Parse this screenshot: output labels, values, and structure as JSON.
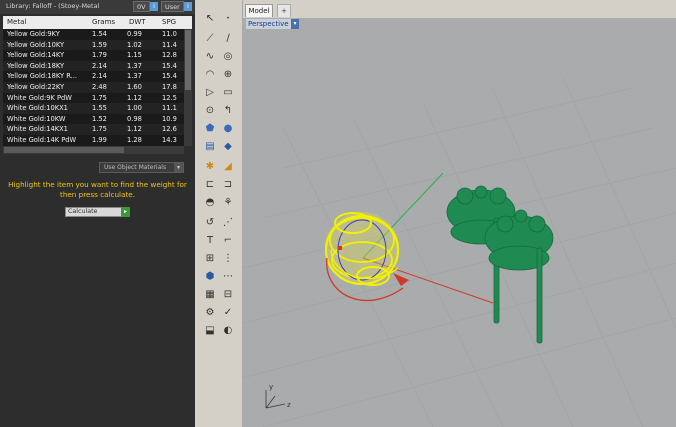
{
  "library": {
    "title": "Library: Falloff - (Stoey-Metal",
    "tag_0v": "0V",
    "tag_user": "User",
    "tag_btn": "i"
  },
  "table": {
    "columns": [
      "Metal",
      "Grams",
      "DWT",
      "SPG"
    ],
    "rows": [
      [
        "Yellow Gold:9KY",
        "1.54",
        "0.99",
        "11.0"
      ],
      [
        "Yellow Gold:10KY",
        "1.59",
        "1.02",
        "11.4"
      ],
      [
        "Yellow Gold:14KY",
        "1.79",
        "1.15",
        "12.8"
      ],
      [
        "Yellow Gold:18KY",
        "2.14",
        "1.37",
        "15.4"
      ],
      [
        "Yellow Gold:18KY R...",
        "2.14",
        "1.37",
        "15.4"
      ],
      [
        "Yellow Gold:22KY",
        "2.48",
        "1.60",
        "17.8"
      ],
      [
        "White Gold:9K PdW",
        "1.75",
        "1.12",
        "12.5"
      ],
      [
        "White Gold:10KX1",
        "1.55",
        "1.00",
        "11.1"
      ],
      [
        "White Gold:10KW",
        "1.52",
        "0.98",
        "10.9"
      ],
      [
        "White Gold:14KX1",
        "1.75",
        "1.12",
        "12.6"
      ],
      [
        "White Gold:14K PdW",
        "1.99",
        "1.28",
        "14.3"
      ]
    ]
  },
  "use_object_materials": "Use Object Materials",
  "hint": "Highlight the item you want to find the weight for then press calculate.",
  "calculate": {
    "value": "Calculate",
    "button": "▸"
  },
  "viewport": {
    "tab_model": "Model",
    "tab_add": "+",
    "label": "Perspective",
    "dropdown": "▾",
    "axis_y": "y",
    "axis_z": "z"
  },
  "colors": {
    "panel_bg": "#2d2d2d",
    "hint_text": "#f0c419",
    "viewport_bg": "#a9abac",
    "selected_object": "#f2f200",
    "green_objects": "#1f8a52"
  },
  "toolbar_icons": [
    "select-arrow-icon",
    "point-icon",
    "polyline-icon",
    "line-icon",
    "curve-icon",
    "circle-icon",
    "arc-icon",
    "ellipse-icon",
    "polygon-icon",
    "rectangle-icon",
    "offset-curve-icon",
    "fillet-icon",
    "box-icon",
    "sphere-icon",
    "cylinder-icon",
    "extrude-icon",
    "surface-icon",
    "patch-icon",
    "boolean-icon",
    "explode-icon",
    "move-icon",
    "rotate-icon",
    "scale-icon",
    "mirror-icon",
    "array-icon",
    "group-icon",
    "block-icon",
    "layer-icon",
    "grid-icon",
    "snap-icon",
    "analyze-icon",
    "check-icon",
    "render-icon",
    "material-icon"
  ]
}
